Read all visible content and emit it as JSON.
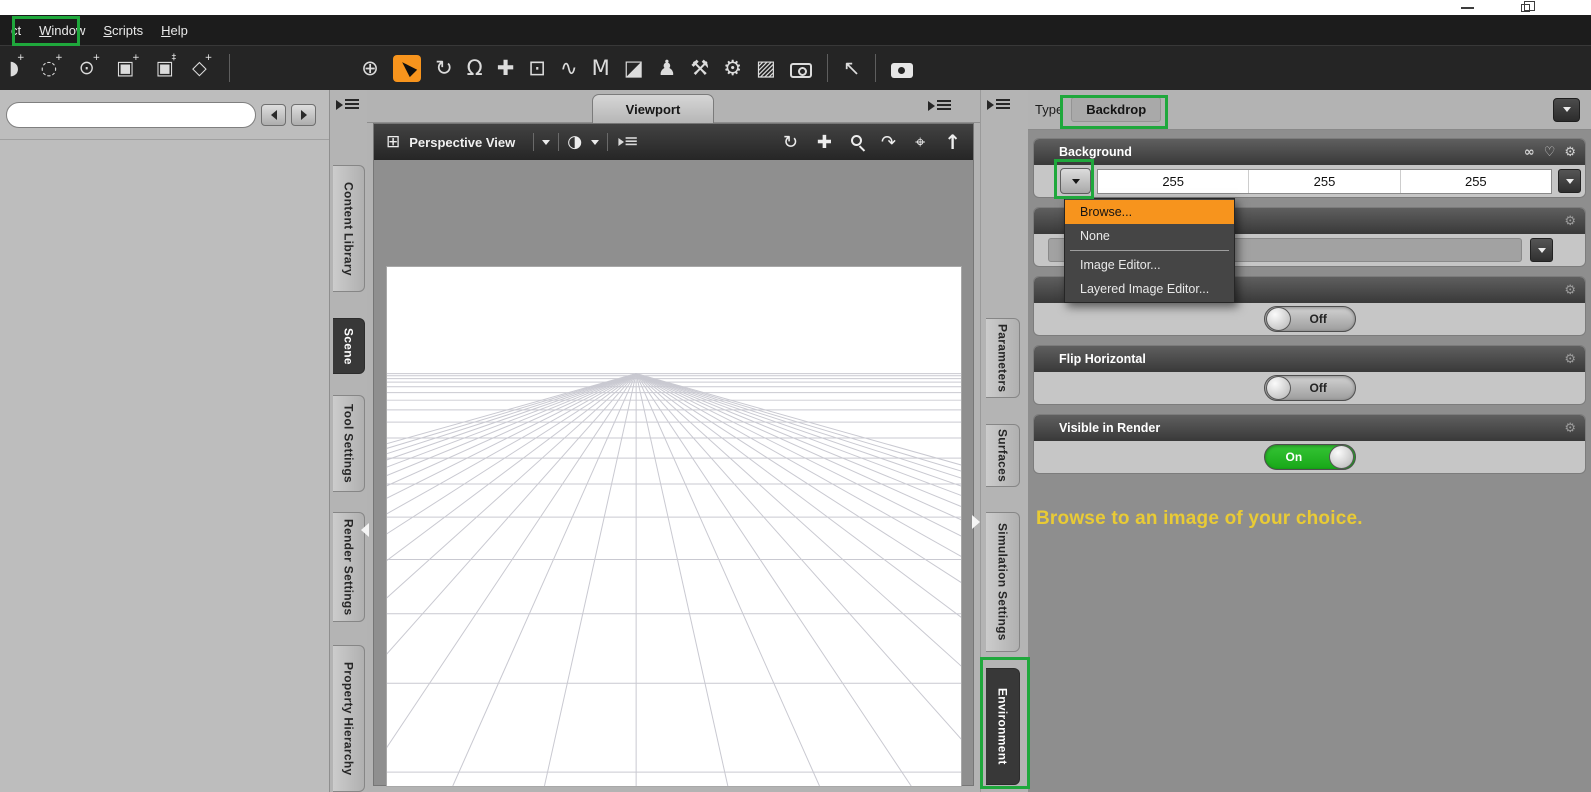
{
  "colors": {
    "annotation_green": "#1fa83c",
    "highlight_orange": "#f7941d",
    "toggle_green": "#18a818",
    "hint_yellow": "#e9cb35"
  },
  "menubar": {
    "items": [
      {
        "label": "ct"
      },
      {
        "label": "Window"
      },
      {
        "label": "Scripts"
      },
      {
        "label": "Help"
      }
    ]
  },
  "toolbar": {
    "left_icons": [
      {
        "name": "partial-node-tool",
        "glyph": "◗",
        "mark": "+"
      },
      {
        "name": "frame-node-tool",
        "glyph": "◌",
        "mark": "+"
      },
      {
        "name": "target-node-tool",
        "glyph": "⊙",
        "mark": "+"
      },
      {
        "name": "new-node-tool",
        "glyph": "▣",
        "mark": "+"
      },
      {
        "name": "group-node-tool",
        "glyph": "▣",
        "mark": "‡"
      },
      {
        "name": "instance-node-tool",
        "glyph": "◇",
        "mark": "+"
      }
    ],
    "main_icons": [
      {
        "name": "universal-tool",
        "glyph": "⊕"
      },
      {
        "name": "node-selection-tool",
        "glyph": "►"
      },
      {
        "name": "rotate-tool",
        "glyph": "↻"
      },
      {
        "name": "active-pose-tool",
        "glyph": "Ω"
      },
      {
        "name": "translate-tool",
        "glyph": "✚"
      },
      {
        "name": "scale-tool",
        "glyph": "⊡"
      },
      {
        "name": "dform-tool",
        "glyph": "∿"
      },
      {
        "name": "animate-tool",
        "glyph": "M"
      },
      {
        "name": "geometry-editor-tool",
        "glyph": "◪"
      },
      {
        "name": "figure-setup-tool",
        "glyph": "♟"
      },
      {
        "name": "tool-a",
        "glyph": "⚒"
      },
      {
        "name": "tool-b",
        "glyph": "⚙"
      },
      {
        "name": "surface-selection-tool",
        "glyph": "▨"
      },
      {
        "name": "camera-cursor-tool",
        "glyph": ""
      },
      {
        "name": "help-pointer-tool",
        "glyph": "↖"
      },
      {
        "name": "render-camera-tool",
        "glyph": ""
      }
    ]
  },
  "left_panel": {
    "filter_value": "",
    "tabs": [
      {
        "label": "Content Library"
      },
      {
        "label": "Scene",
        "active": true
      },
      {
        "label": "Tool Settings"
      },
      {
        "label": "Render Settings"
      },
      {
        "label": "Property Hierarchy"
      }
    ]
  },
  "viewport": {
    "tab_label": "Viewport",
    "view_selector": {
      "grid_icon": "⊞",
      "label": "Perspective View",
      "shade_icon": "◑"
    },
    "nav_icons": [
      {
        "name": "orbit",
        "glyph": "↻"
      },
      {
        "name": "pan",
        "glyph": "✚"
      },
      {
        "name": "zoom",
        "glyph": ""
      },
      {
        "name": "spin",
        "glyph": "↷"
      },
      {
        "name": "frame",
        "glyph": "⌖"
      },
      {
        "name": "reset-view",
        "glyph": "↑"
      }
    ]
  },
  "right_tabs": [
    {
      "label": "Parameters"
    },
    {
      "label": "Surfaces"
    },
    {
      "label": "Simulation Settings"
    },
    {
      "label": "Environment",
      "active": true
    }
  ],
  "environment_pane": {
    "type_label": "Type",
    "type_value": "Backdrop",
    "card_icons": {
      "link_glyph": "∞",
      "heart_glyph": "♡",
      "gear_glyph": "⚙"
    },
    "background_section": {
      "title": "Background",
      "values": [
        "255",
        "255",
        "255"
      ]
    },
    "hidden_section_1": {
      "title": ""
    },
    "hidden_section_2": {
      "title": "",
      "toggle_label": "Off"
    },
    "flip_horizontal_section": {
      "title": "Flip Horizontal",
      "toggle_label": "Off"
    },
    "visible_in_render_section": {
      "title": "Visible in Render",
      "toggle_label": "On"
    },
    "context_menu": {
      "items": [
        {
          "label": "Browse...",
          "highlighted": true
        },
        {
          "label": "None"
        },
        {
          "label": "Image Editor..."
        },
        {
          "label": "Layered Image Editor..."
        }
      ]
    },
    "hint_text": "Browse to an image of your choice."
  }
}
